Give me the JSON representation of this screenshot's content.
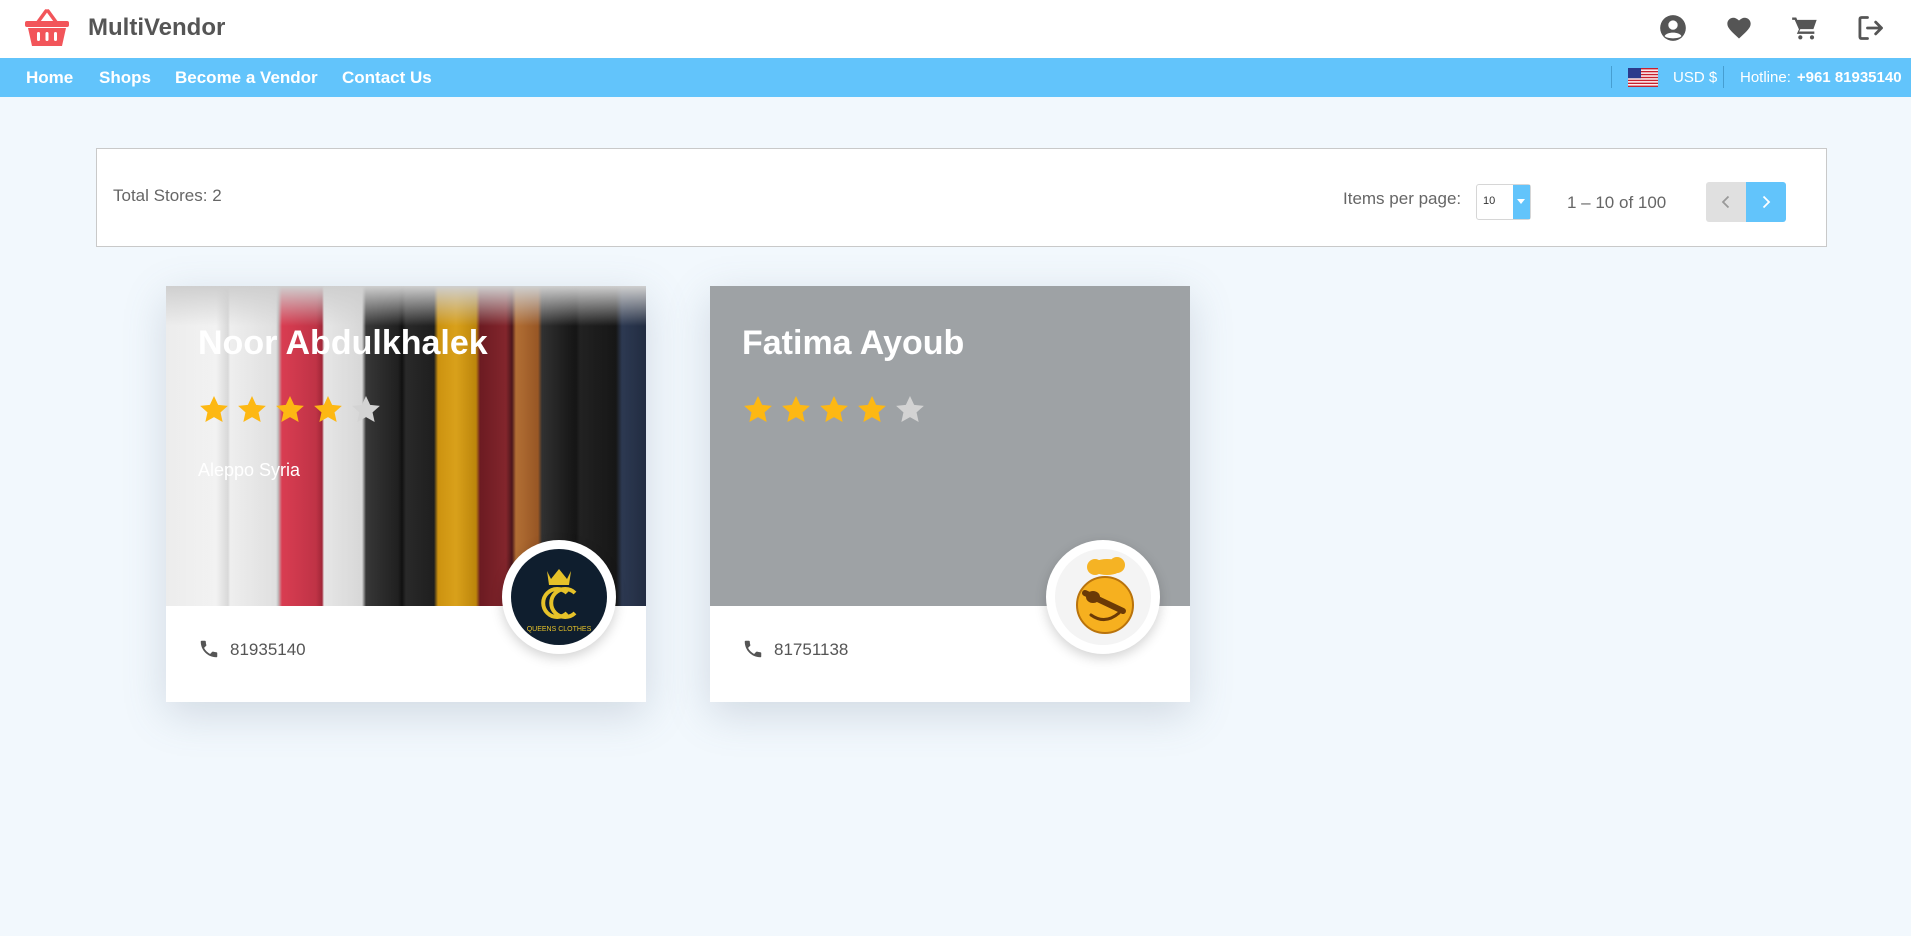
{
  "header": {
    "brand": "MultiVendor",
    "icons": [
      "basket-logo-icon",
      "account-icon",
      "heart-icon",
      "cart-icon",
      "logout-icon"
    ]
  },
  "nav": {
    "links": [
      "Home",
      "Shops",
      "Become a Vendor",
      "Contact Us"
    ],
    "currency": "USD $",
    "hotline_label": "Hotline:",
    "hotline_number": "+961 81935140"
  },
  "toolbar": {
    "total_stores": "Total Stores: 2",
    "items_per_page_label": "Items per page:",
    "items_per_page_value": "10",
    "range_text": "1 – 10 of 100"
  },
  "stores": [
    {
      "name": "Noor Abdulkhalek",
      "rating": 4,
      "rating_max": 5,
      "location": "Aleppo Syria",
      "phone": "81935140",
      "logo_text": "QUEENS CLOTHES"
    },
    {
      "name": "Fatima Ayoub",
      "rating": 4,
      "rating_max": 5,
      "location": "",
      "phone": "81751138"
    }
  ],
  "colors": {
    "accent": "#62c4fb",
    "logo_red": "#f2555a",
    "star_filled": "#fdb813",
    "star_empty": "#d3d3d3",
    "page_bg": "#f2f8fd"
  }
}
